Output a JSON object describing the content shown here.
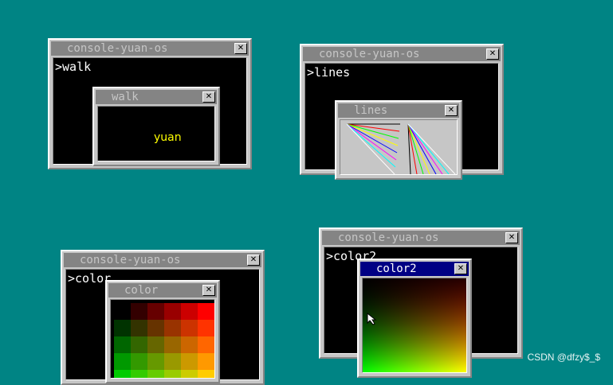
{
  "consoles": [
    {
      "title": "console-yuan-os",
      "prompt": ">",
      "command": "walk"
    },
    {
      "title": "console-yuan-os",
      "prompt": ">",
      "command": "lines"
    },
    {
      "title": "console-yuan-os",
      "prompt": ">",
      "command": "color"
    },
    {
      "title": "console-yuan-os",
      "prompt": ">",
      "command": "color2"
    }
  ],
  "apps": {
    "walk": {
      "title": "walk",
      "text": "yuan"
    },
    "lines": {
      "title": "lines"
    },
    "color": {
      "title": "color"
    },
    "color2": {
      "title": "color2"
    }
  },
  "close_glyph": "✕",
  "watermark": "CSDN @dfzy$_$",
  "colors": {
    "desktop": "#008484",
    "window": "#c6c6c6",
    "title_inactive": "#848484",
    "title_active": "#000084",
    "console_bg": "#000000",
    "walker_text": "#ffff00"
  }
}
